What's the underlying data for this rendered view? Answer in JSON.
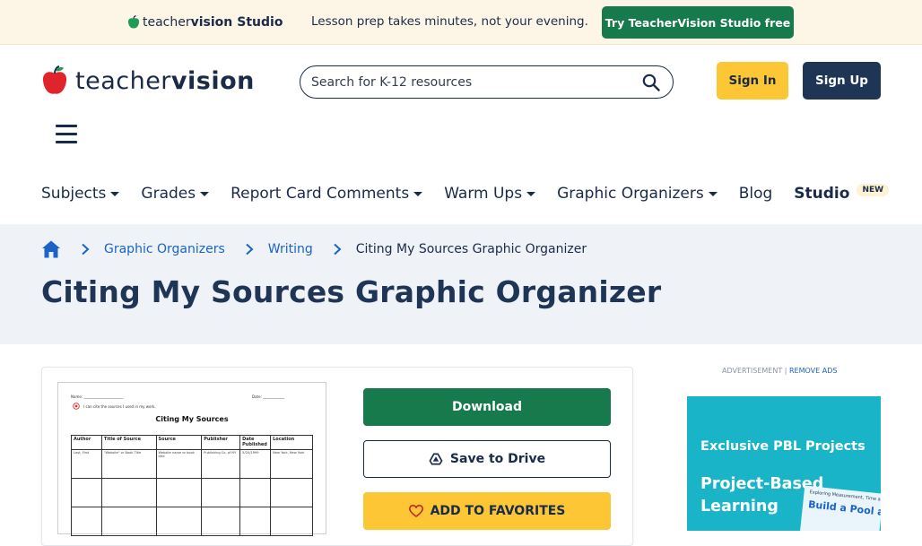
{
  "promo": {
    "logo_word1": "teacher",
    "logo_word2": "vision",
    "logo_word3": "Studio",
    "text": "Lesson prep takes minutes, not your evening.",
    "cta": "Try TeacherVision Studio free"
  },
  "header": {
    "logo_word1": "teacher",
    "logo_word2": "vision",
    "search_placeholder": "Search for K-12 resources",
    "sign_in": "Sign In",
    "sign_up": "Sign Up"
  },
  "nav": {
    "items": [
      {
        "label": "Subjects",
        "dropdown": true
      },
      {
        "label": "Grades",
        "dropdown": true
      },
      {
        "label": "Report Card Comments",
        "dropdown": true
      },
      {
        "label": "Warm Ups",
        "dropdown": true
      },
      {
        "label": "Graphic Organizers",
        "dropdown": true
      },
      {
        "label": "Blog",
        "dropdown": false
      }
    ],
    "studio": "Studio",
    "studio_badge": "NEW"
  },
  "breadcrumb": {
    "items": [
      "Graphic Organizers",
      "Writing"
    ],
    "current": "Citing My Sources Graphic Organizer"
  },
  "page": {
    "title": "Citing My Sources Graphic Organizer"
  },
  "worksheet": {
    "name_label": "Name: ______________________",
    "date_label": "Date: ____________",
    "objective": "I can cite the sources I used in my work.",
    "title": "Citing My Sources",
    "headers": [
      "Author",
      "Title of Source",
      "Source",
      "Publisher",
      "Date Published",
      "Location"
    ],
    "example_row": [
      "Last, First",
      "\"Website\" or Book Title",
      "Website name or book title",
      "Publishing Co. of NY",
      "5/20/1999",
      "New York, New York"
    ]
  },
  "actions": {
    "download": "Download",
    "save_to_drive": "Save to Drive",
    "add_to_favorites": "ADD TO FAVORITES"
  },
  "ad": {
    "label": "ADVERTISEMENT |",
    "remove": "REMOVE ADS",
    "headline": "Exclusive PBL Projects",
    "subhead": "Project-Based Learning",
    "book_tag": "Exploring Measurement, Time and Shipping",
    "book_title": "Build a Pool at"
  },
  "colors": {
    "navy": "#1a2b4a",
    "green": "#167a4c",
    "yellow": "#fcc634",
    "link": "#1a64c8",
    "ad_teal": "#1ab4c8"
  }
}
